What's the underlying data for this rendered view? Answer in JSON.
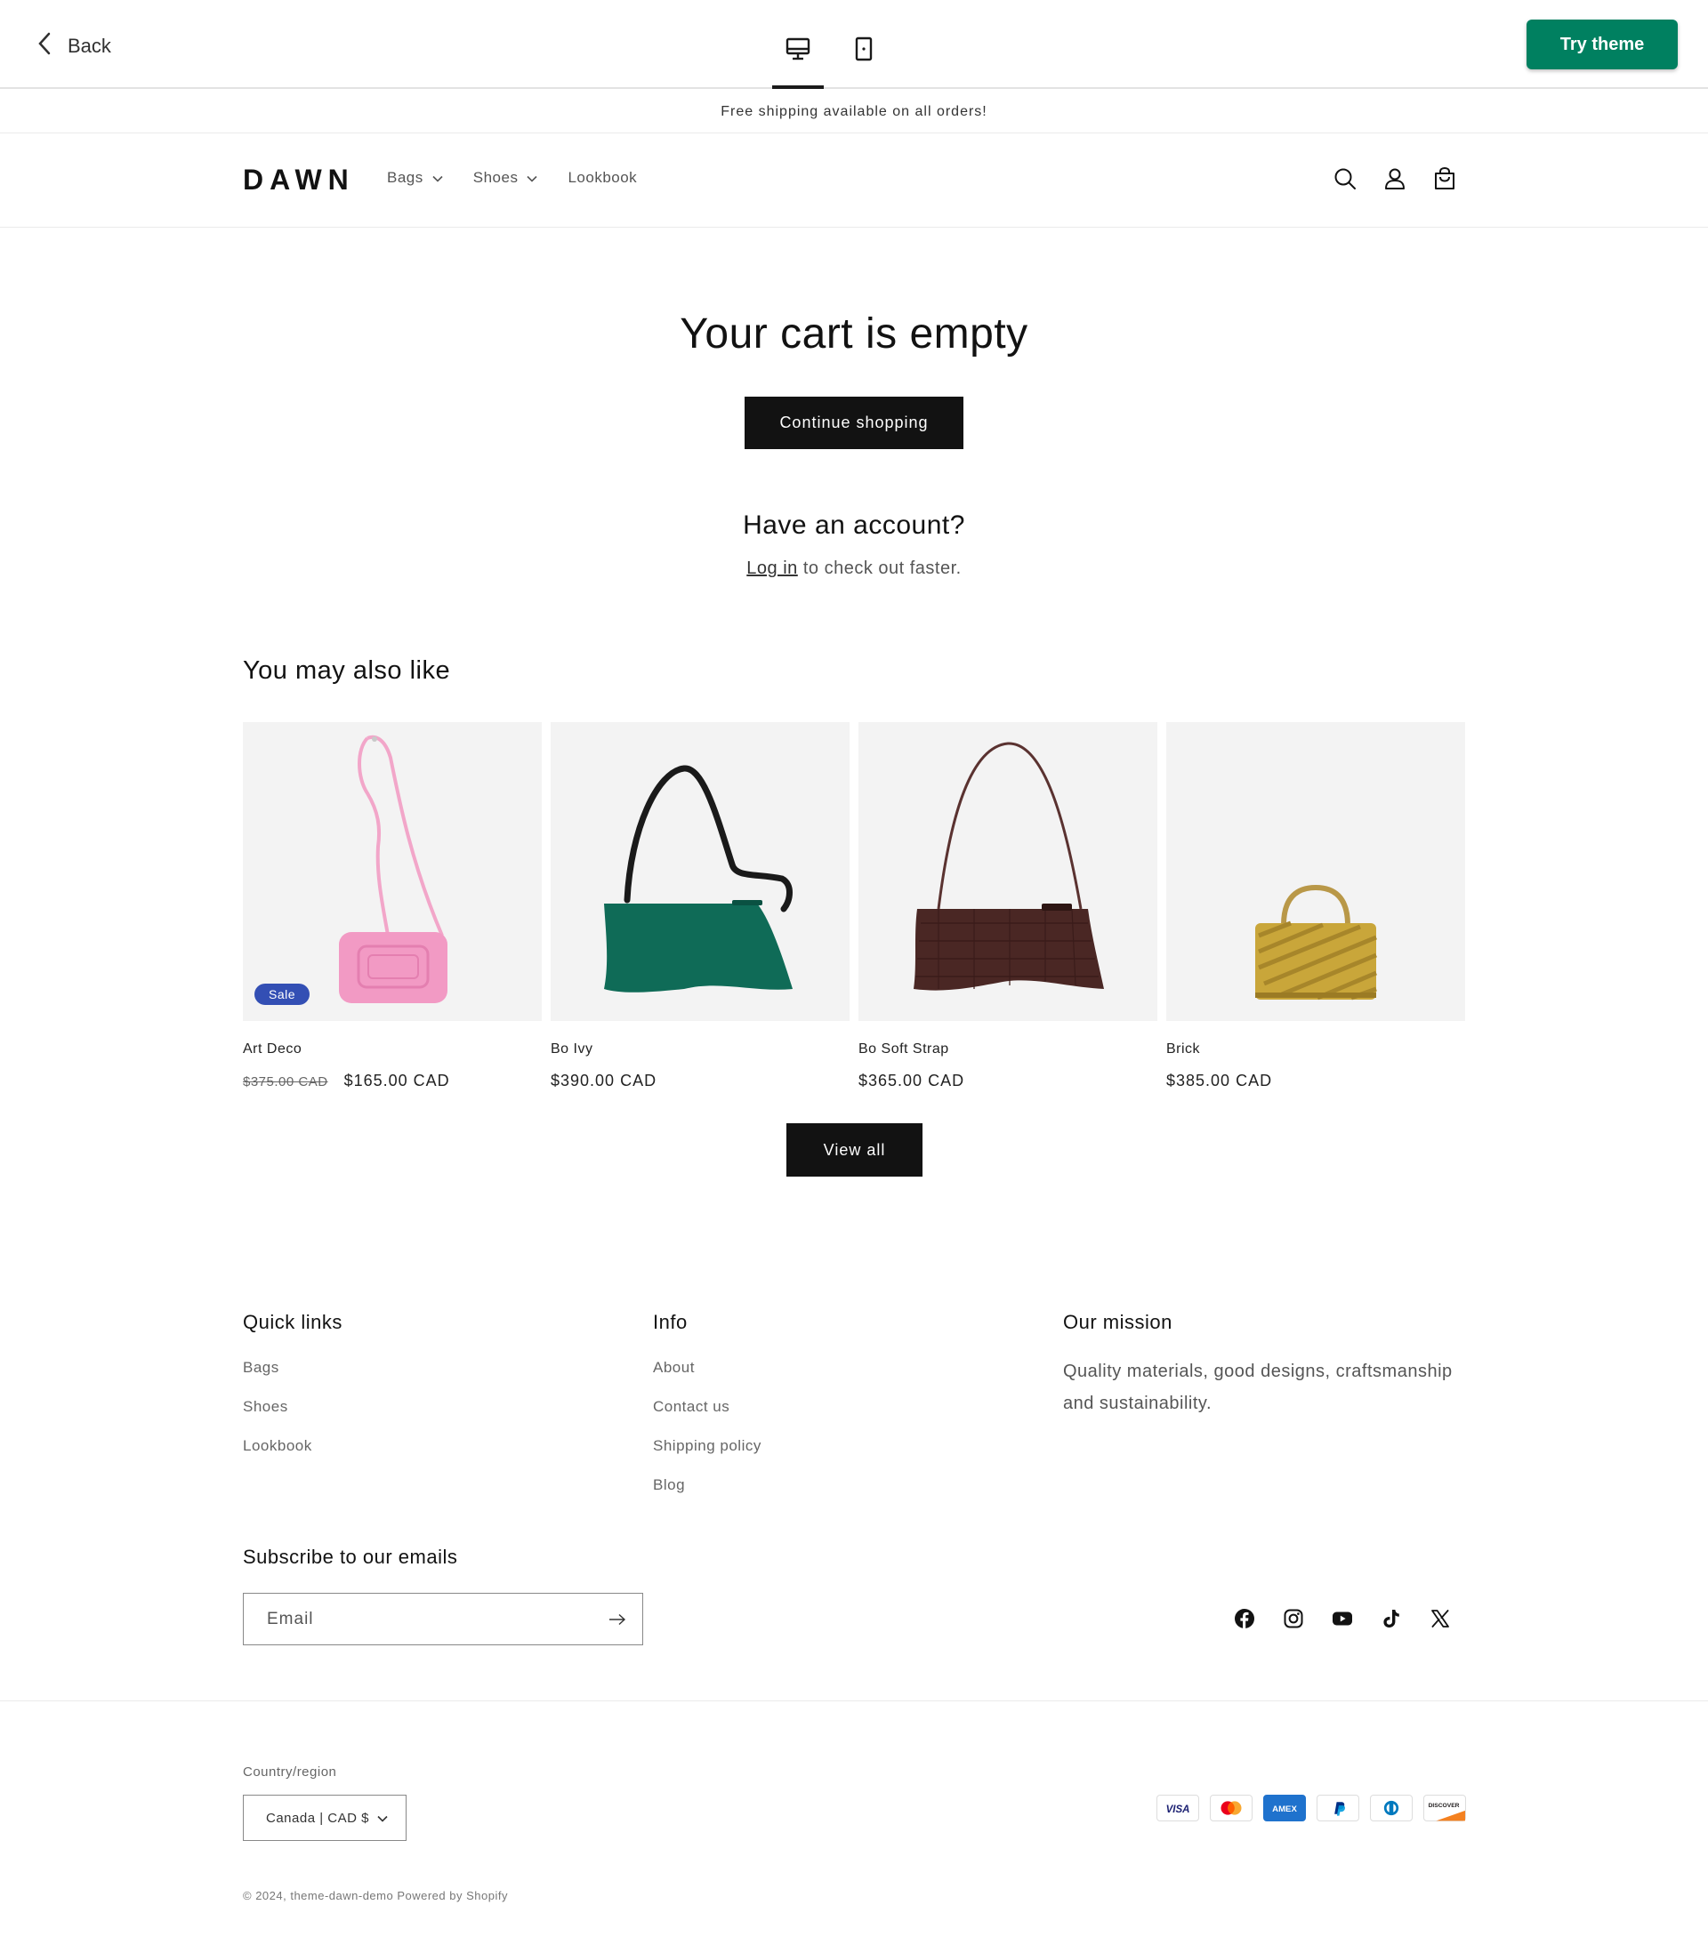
{
  "preview_bar": {
    "back_label": "Back",
    "try_theme_label": "Try theme",
    "accent_color": "#008060"
  },
  "announcement": "Free shipping available on all orders!",
  "header": {
    "logo": "DAWN",
    "nav": [
      {
        "label": "Bags",
        "has_dropdown": true
      },
      {
        "label": "Shoes",
        "has_dropdown": true
      },
      {
        "label": "Lookbook",
        "has_dropdown": false
      }
    ],
    "icons": [
      "search-icon",
      "account-icon",
      "cart-icon"
    ]
  },
  "cart": {
    "title": "Your cart is empty",
    "continue_label": "Continue shopping",
    "account_title": "Have an account?",
    "login_link": "Log in",
    "login_suffix": " to check out faster."
  },
  "recommendations": {
    "title": "You may also like",
    "products": [
      {
        "name": "Art Deco",
        "compare_price": "$375.00 CAD",
        "price": "$165.00 CAD",
        "badge": "Sale",
        "color": "#f29ac4"
      },
      {
        "name": "Bo Ivy",
        "compare_price": "",
        "price": "$390.00 CAD",
        "badge": "",
        "color": "#0f6b57"
      },
      {
        "name": "Bo Soft Strap",
        "compare_price": "",
        "price": "$365.00 CAD",
        "badge": "",
        "color": "#4a2724"
      },
      {
        "name": "Brick",
        "compare_price": "",
        "price": "$385.00 CAD",
        "badge": "",
        "color": "#c9a63a"
      }
    ],
    "view_all_label": "View all",
    "sale_badge_color": "#334fb4"
  },
  "footer": {
    "quick_links": {
      "title": "Quick links",
      "items": [
        "Bags",
        "Shoes",
        "Lookbook"
      ]
    },
    "info": {
      "title": "Info",
      "items": [
        "About",
        "Contact us",
        "Shipping policy",
        "Blog"
      ]
    },
    "mission": {
      "title": "Our mission",
      "text": "Quality materials, good designs, craftsmanship and sustainability."
    },
    "subscribe_title": "Subscribe to our emails",
    "email_placeholder": "Email",
    "socials": [
      "facebook-icon",
      "instagram-icon",
      "youtube-icon",
      "tiktok-icon",
      "x-icon"
    ],
    "country_label": "Country/region",
    "country_value": "Canada | CAD $",
    "payments": [
      "VISA",
      "mastercard",
      "AMEX",
      "PayPal",
      "Diners Club",
      "DISCOVER"
    ],
    "copyright": "© 2024, theme-dawn-demo Powered by Shopify"
  }
}
